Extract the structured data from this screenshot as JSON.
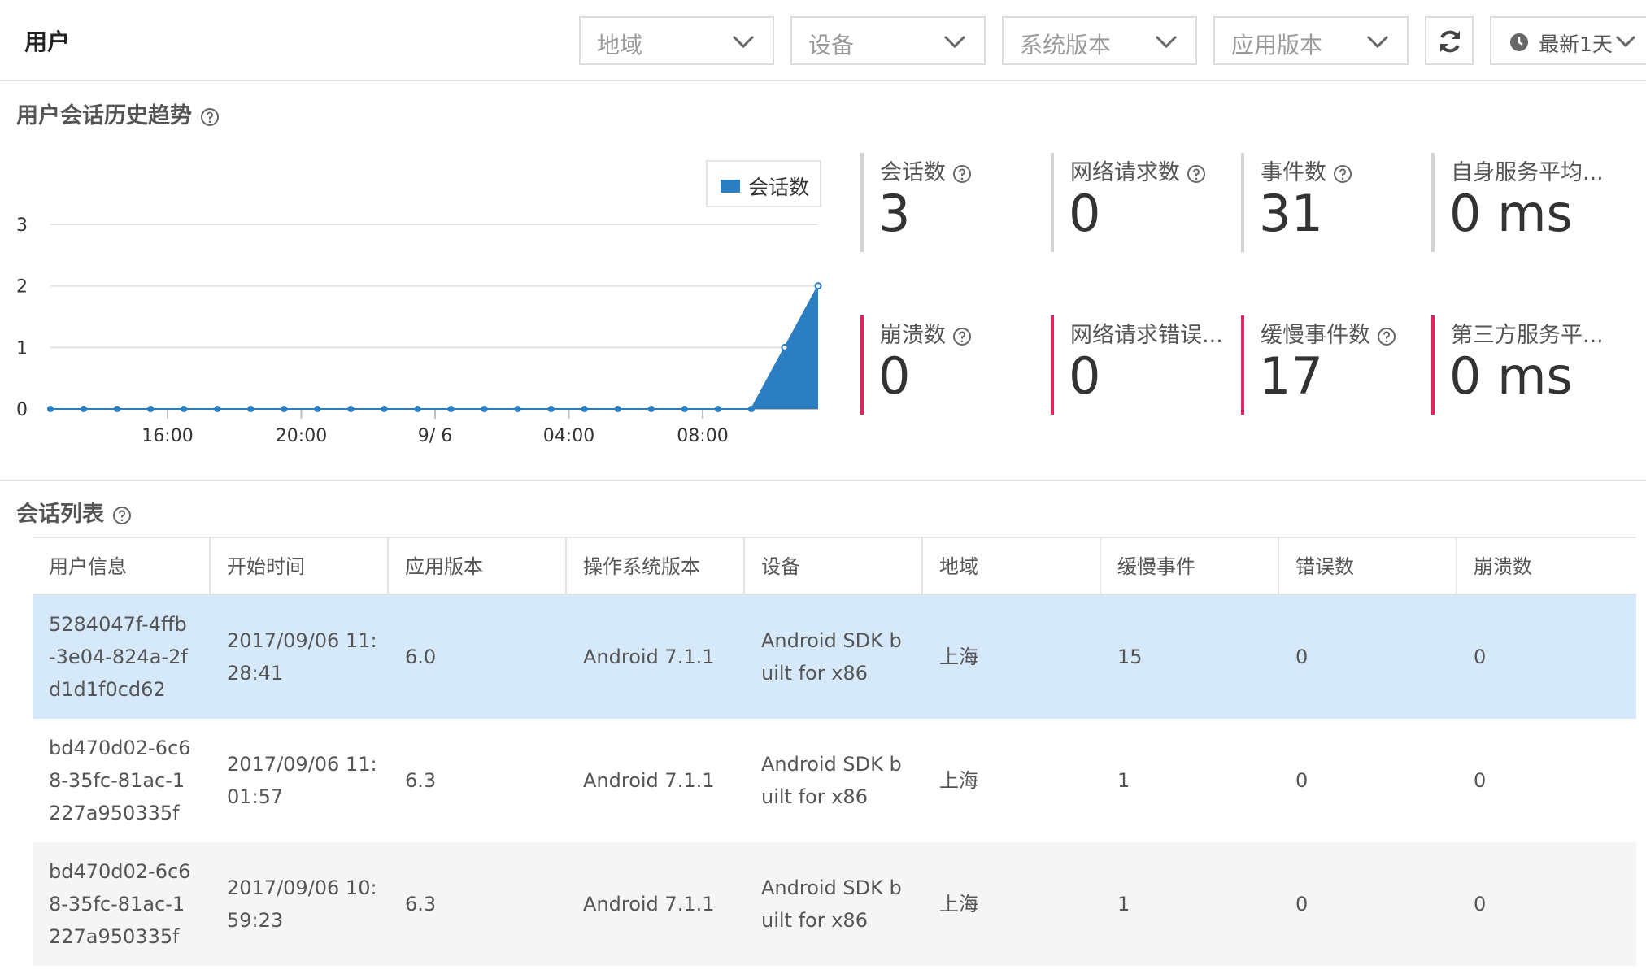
{
  "header": {
    "title": "用户",
    "filters": [
      {
        "placeholder": "地域"
      },
      {
        "placeholder": "设备"
      },
      {
        "placeholder": "系统版本"
      },
      {
        "placeholder": "应用版本"
      }
    ],
    "time_range": "最新1天"
  },
  "trend": {
    "title": "用户会话历史趋势"
  },
  "chart_data": {
    "type": "area",
    "title": "",
    "xlabel": "",
    "ylabel": "",
    "y_ticks": [
      "0",
      "1",
      "2",
      "3"
    ],
    "ylim": [
      0,
      3
    ],
    "x_tick_labels": [
      "16:00",
      "20:00",
      "9/ 6",
      "04:00",
      "08:00"
    ],
    "legend": "top-right",
    "grid": true,
    "series": [
      {
        "name": "会话数",
        "color": "#2b7ec2",
        "values": [
          0,
          0,
          0,
          0,
          0,
          0,
          0,
          0,
          0,
          0,
          0,
          0,
          0,
          0,
          0,
          0,
          0,
          0,
          0,
          0,
          0,
          0,
          1,
          2
        ]
      }
    ]
  },
  "stats": [
    {
      "label": "会话数",
      "value": "3",
      "help": true,
      "alert": false
    },
    {
      "label": "网络请求数",
      "value": "0",
      "help": true,
      "alert": false
    },
    {
      "label": "事件数",
      "value": "31",
      "help": true,
      "alert": false
    },
    {
      "label": "自身服务平均...",
      "value": "0 ms",
      "help": false,
      "alert": false
    },
    {
      "label": "崩溃数",
      "value": "0",
      "help": true,
      "alert": true
    },
    {
      "label": "网络请求错误...",
      "value": "0",
      "help": false,
      "alert": true
    },
    {
      "label": "缓慢事件数",
      "value": "17",
      "help": true,
      "alert": true
    },
    {
      "label": "第三方服务平...",
      "value": "0 ms",
      "help": false,
      "alert": true
    }
  ],
  "sessions": {
    "title": "会话列表",
    "columns": [
      "用户信息",
      "开始时间",
      "应用版本",
      "操作系统版本",
      "设备",
      "地域",
      "缓慢事件",
      "错误数",
      "崩溃数"
    ],
    "rows": [
      {
        "user": [
          "5284047f-4ffb",
          "-3e04-824a-2f",
          "d1d1f0cd62"
        ],
        "start": [
          "2017/09/06 11:",
          "28:41"
        ],
        "app_version": "6.0",
        "os_version": "Android 7.1.1",
        "device": [
          "Android SDK b",
          "uilt for x86"
        ],
        "region": "上海",
        "slow_events": "15",
        "errors": "0",
        "crashes": "0"
      },
      {
        "user": [
          "bd470d02-6c6",
          "8-35fc-81ac-1",
          "227a950335f"
        ],
        "start": [
          "2017/09/06 11:",
          "01:57"
        ],
        "app_version": "6.3",
        "os_version": "Android 7.1.1",
        "device": [
          "Android SDK b",
          "uilt for x86"
        ],
        "region": "上海",
        "slow_events": "1",
        "errors": "0",
        "crashes": "0"
      },
      {
        "user": [
          "bd470d02-6c6",
          "8-35fc-81ac-1",
          "227a950335f"
        ],
        "start": [
          "2017/09/06 10:",
          "59:23"
        ],
        "app_version": "6.3",
        "os_version": "Android 7.1.1",
        "device": [
          "Android SDK b",
          "uilt for x86"
        ],
        "region": "上海",
        "slow_events": "1",
        "errors": "0",
        "crashes": "0"
      }
    ]
  }
}
